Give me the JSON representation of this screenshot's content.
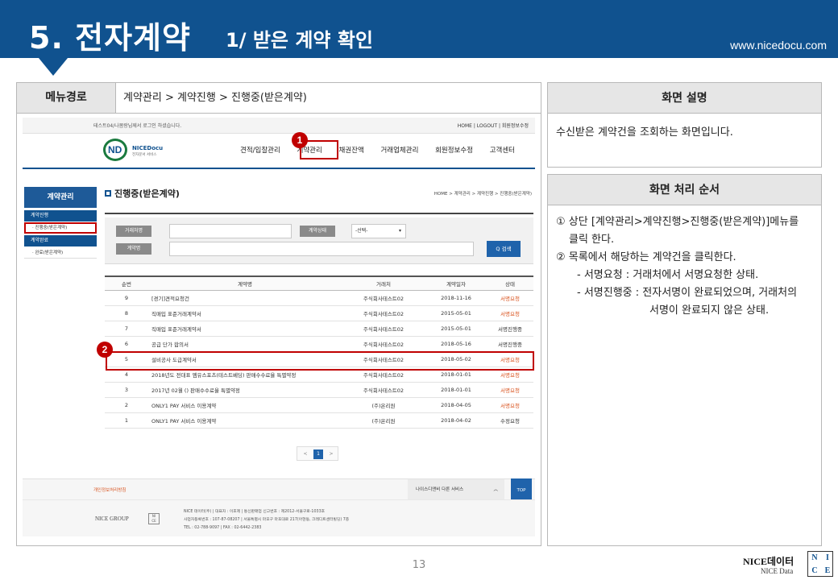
{
  "header": {
    "title": "5. 전자계약",
    "subtitle": "1/ 받은 계약 확인",
    "url": "www.nicedocu.com"
  },
  "menu_path": {
    "label": "메뉴경로",
    "value": "계약관리 > 계약진행 > 진행중(받은계약)"
  },
  "screen_desc": {
    "title": "화면 설명",
    "text": "수신받은 계약건을 조회하는 화면입니다."
  },
  "process": {
    "title": "화면 처리 순서",
    "lines": [
      "① 상단 [계약관리>계약진행>진행중(받은계약)]메뉴를",
      "클릭 한다.",
      "② 목록에서 해당하는 계약건을 클릭한다.",
      "- 서명요청 : 거래처에서 서명요청한 상태.",
      "- 서명진행중 : 전자서명이 완료되었으며, 거래처의",
      "서명이 완료되지 않은 상태."
    ]
  },
  "app": {
    "login_msg": "테스트04/나몸랑님께서 로그인 하셨습니다.",
    "top_links": "HOME  |  LOGOUT  |  회원정보수정",
    "logo_text": "NICEDocu",
    "logo_sub": "전자문서 서비스",
    "gnb": [
      "견적/입찰관리",
      "계약관리",
      "채권잔액",
      "거래업체관리",
      "회원정보수정",
      "고객센터"
    ],
    "lnb": {
      "head": "계약관리",
      "sec1": "계약진행",
      "item1": "· 진행중(받은계약)",
      "sec2": "계약완료",
      "item2": "· 완료(받은계약)"
    },
    "page_title": "진행중(받은계약)",
    "breadcrumb": "HOME > 계약관리 > 계약진행 > 진행중(받은계약)",
    "search": {
      "partner_label": "거래처명",
      "status_label": "계약상태",
      "status_value": "-선택-",
      "name_label": "계약명",
      "button": "Q 검색"
    },
    "table": {
      "headers": [
        "순번",
        "계약명",
        "거래처",
        "계약일자",
        "상태"
      ],
      "rows": [
        [
          "9",
          "[경기]견적요청건",
          "주식회사테스트02",
          "2018-11-16",
          "서명요청"
        ],
        [
          "8",
          "직매입 표준거래계약서",
          "주식회사테스트02",
          "2015-05-01",
          "서명요청"
        ],
        [
          "7",
          "직매입 표준거래계약서",
          "주식회사테스트02",
          "2015-05-01",
          "서명진행중"
        ],
        [
          "6",
          "공급 단가 합의서",
          "주식회사테스트02",
          "2018-05-16",
          "서명진행중"
        ],
        [
          "5",
          "설비공사 도급계약서",
          "주식회사테스트02",
          "2018-05-02",
          "서명요청"
        ],
        [
          "4",
          "2018년도 전대표 엠유스포츠(테스트베딩) 판매수수료율 특별약정",
          "주식회사테스트02",
          "2018-01-01",
          "서명요청"
        ],
        [
          "3",
          "2017년 02월 () 판매수수료율 특별약정",
          "주식회사테스트02",
          "2018-01-01",
          "서명요청"
        ],
        [
          "2",
          "ONLY1 PAY 서비스 이용계약",
          "(주)온리원",
          "2018-04-05",
          "서명요청"
        ],
        [
          "1",
          "ONLY1 PAY 서비스 이용계약",
          "(주)온리원",
          "2018-04-02",
          "수정요청"
        ]
      ]
    },
    "pager": {
      "prev": "<",
      "current": "1",
      "next": ">"
    },
    "footer": {
      "privacy": "개인정보처리방침",
      "family": "나이스디앤비 다른 서비스",
      "top": "TOP",
      "group": "NICE GROUP",
      "info1": "NICE 데이터(주)  |  대표자 : 이호제  |  통신판매업 신고번호 : 제2012-서울구로-1033호",
      "info2": "사업자등록번호 : 107-87-08207  |  서울특별시 마포구 마포대로 217(아현동, 크레디트센터빌딩) 7층",
      "info3": "TEL : 02-788-9097  |  FAX : 02-6442-2383"
    }
  },
  "badges": [
    "1",
    "2"
  ],
  "page_number": "13",
  "brand": {
    "name": "NICE데이터",
    "sub": "NICE Data",
    "logo": [
      "N",
      "I",
      "C",
      "E"
    ]
  },
  "colors": {
    "header_blue": "#10528f",
    "highlight_red": "#c00000",
    "status_orange": "#d9531e"
  }
}
